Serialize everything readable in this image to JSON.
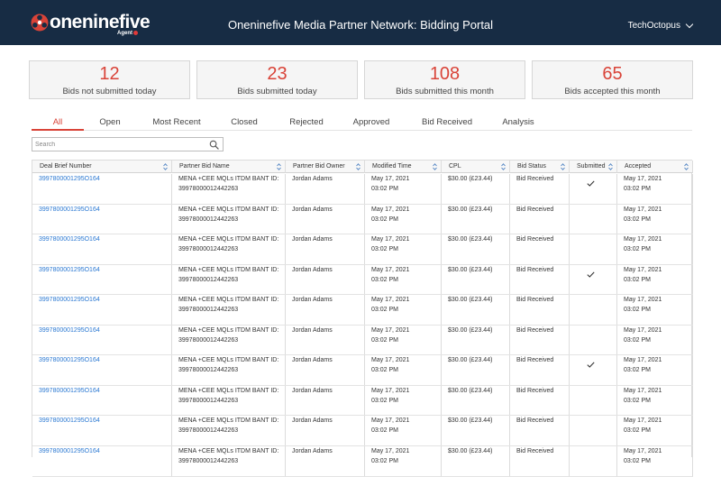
{
  "header": {
    "logo_text": "oneninefive",
    "logo_subtext": "Agent",
    "title": "Oneninefive Media Partner Network: Bidding Portal",
    "user_name": "TechOctopus",
    "brand_color": "#d94338",
    "header_bg": "#172c44"
  },
  "stats": [
    {
      "value": "12",
      "label": "Bids not submitted today"
    },
    {
      "value": "23",
      "label": "Bids submitted today"
    },
    {
      "value": "108",
      "label": "Bids submitted this month"
    },
    {
      "value": "65",
      "label": "Bids accepted this month"
    }
  ],
  "tabs": [
    {
      "label": "All",
      "active": true
    },
    {
      "label": "Open",
      "active": false
    },
    {
      "label": "Most Recent",
      "active": false
    },
    {
      "label": "Closed",
      "active": false
    },
    {
      "label": "Rejected",
      "active": false
    },
    {
      "label": "Approved",
      "active": false
    },
    {
      "label": "Bid Received",
      "active": false
    },
    {
      "label": "Analysis",
      "active": false
    }
  ],
  "search": {
    "placeholder": "Search",
    "value": "",
    "icon": "search-icon"
  },
  "table": {
    "columns": [
      "Deal Brief Number",
      "Partner Bid Name",
      "Partner Bid Owner",
      "Modified Time",
      "CPL",
      "Bid Status",
      "Submitted",
      "Accepted"
    ],
    "rows": [
      {
        "deal": "3997800001295O164",
        "name1": "MENA +CEE MQLs ITDM BANT ID:",
        "name2": "39978000012442263",
        "owner": "Jordan Adams",
        "mod1": "May 17, 2021",
        "mod2": "03:02 PM",
        "cpl": "$30.00 (£23.44)",
        "status": "Bid Received",
        "submitted": true,
        "acc1": "May 17, 2021",
        "acc2": "03:02 PM"
      },
      {
        "deal": "3997800001295O164",
        "name1": "MENA +CEE MQLs ITDM BANT ID:",
        "name2": "39978000012442263",
        "owner": "Jordan Adams",
        "mod1": "May 17, 2021",
        "mod2": "03:02 PM",
        "cpl": "$30.00 (£23.44)",
        "status": "Bid Received",
        "submitted": false,
        "acc1": "May 17, 2021",
        "acc2": "03:02 PM"
      },
      {
        "deal": "3997800001295O164",
        "name1": "MENA +CEE MQLs ITDM BANT ID:",
        "name2": "39978000012442263",
        "owner": "Jordan Adams",
        "mod1": "May 17, 2021",
        "mod2": "03:02 PM",
        "cpl": "$30.00 (£23.44)",
        "status": "Bid Received",
        "submitted": false,
        "acc1": "May 17, 2021",
        "acc2": "03:02 PM"
      },
      {
        "deal": "3997800001295O164",
        "name1": "MENA +CEE MQLs ITDM BANT ID:",
        "name2": "39978000012442263",
        "owner": "Jordan Adams",
        "mod1": "May 17, 2021",
        "mod2": "03:02 PM",
        "cpl": "$30.00 (£23.44)",
        "status": "Bid Received",
        "submitted": true,
        "acc1": "May 17, 2021",
        "acc2": "03:02 PM"
      },
      {
        "deal": "3997800001295O164",
        "name1": "MENA +CEE MQLs ITDM BANT ID:",
        "name2": "39978000012442263",
        "owner": "Jordan Adams",
        "mod1": "May 17, 2021",
        "mod2": "03:02 PM",
        "cpl": "$30.00 (£23.44)",
        "status": "Bid Received",
        "submitted": false,
        "acc1": "May 17, 2021",
        "acc2": "03:02 PM"
      },
      {
        "deal": "3997800001295O164",
        "name1": "MENA +CEE MQLs ITDM BANT ID:",
        "name2": "39978000012442263",
        "owner": "Jordan Adams",
        "mod1": "May 17, 2021",
        "mod2": "03:02 PM",
        "cpl": "$30.00 (£23.44)",
        "status": "Bid Received",
        "submitted": false,
        "acc1": "May 17, 2021",
        "acc2": "03:02 PM"
      },
      {
        "deal": "3997800001295O164",
        "name1": "MENA +CEE MQLs ITDM BANT ID:",
        "name2": "39978000012442263",
        "owner": "Jordan Adams",
        "mod1": "May 17, 2021",
        "mod2": "03:02 PM",
        "cpl": "$30.00 (£23.44)",
        "status": "Bid Received",
        "submitted": true,
        "acc1": "May 17, 2021",
        "acc2": "03:02 PM"
      },
      {
        "deal": "3997800001295O164",
        "name1": "MENA +CEE MQLs ITDM BANT ID:",
        "name2": "39978000012442263",
        "owner": "Jordan Adams",
        "mod1": "May 17, 2021",
        "mod2": "03:02 PM",
        "cpl": "$30.00 (£23.44)",
        "status": "Bid Received",
        "submitted": false,
        "acc1": "May 17, 2021",
        "acc2": "03:02 PM"
      },
      {
        "deal": "3997800001295O164",
        "name1": "MENA +CEE MQLs ITDM BANT ID:",
        "name2": "39978000012442263",
        "owner": "Jordan Adams",
        "mod1": "May 17, 2021",
        "mod2": "03:02 PM",
        "cpl": "$30.00 (£23.44)",
        "status": "Bid Received",
        "submitted": false,
        "acc1": "May 17, 2021",
        "acc2": "03:02 PM"
      },
      {
        "deal": "3997800001295O164",
        "name1": "MENA +CEE MQLs ITDM BANT ID:",
        "name2": "39978000012442263",
        "owner": "Jordan Adams",
        "mod1": "May 17, 2021",
        "mod2": "03:02 PM",
        "cpl": "$30.00 (£23.44)",
        "status": "Bid Received",
        "submitted": false,
        "acc1": "May 17, 2021",
        "acc2": "03:02 PM"
      }
    ]
  }
}
